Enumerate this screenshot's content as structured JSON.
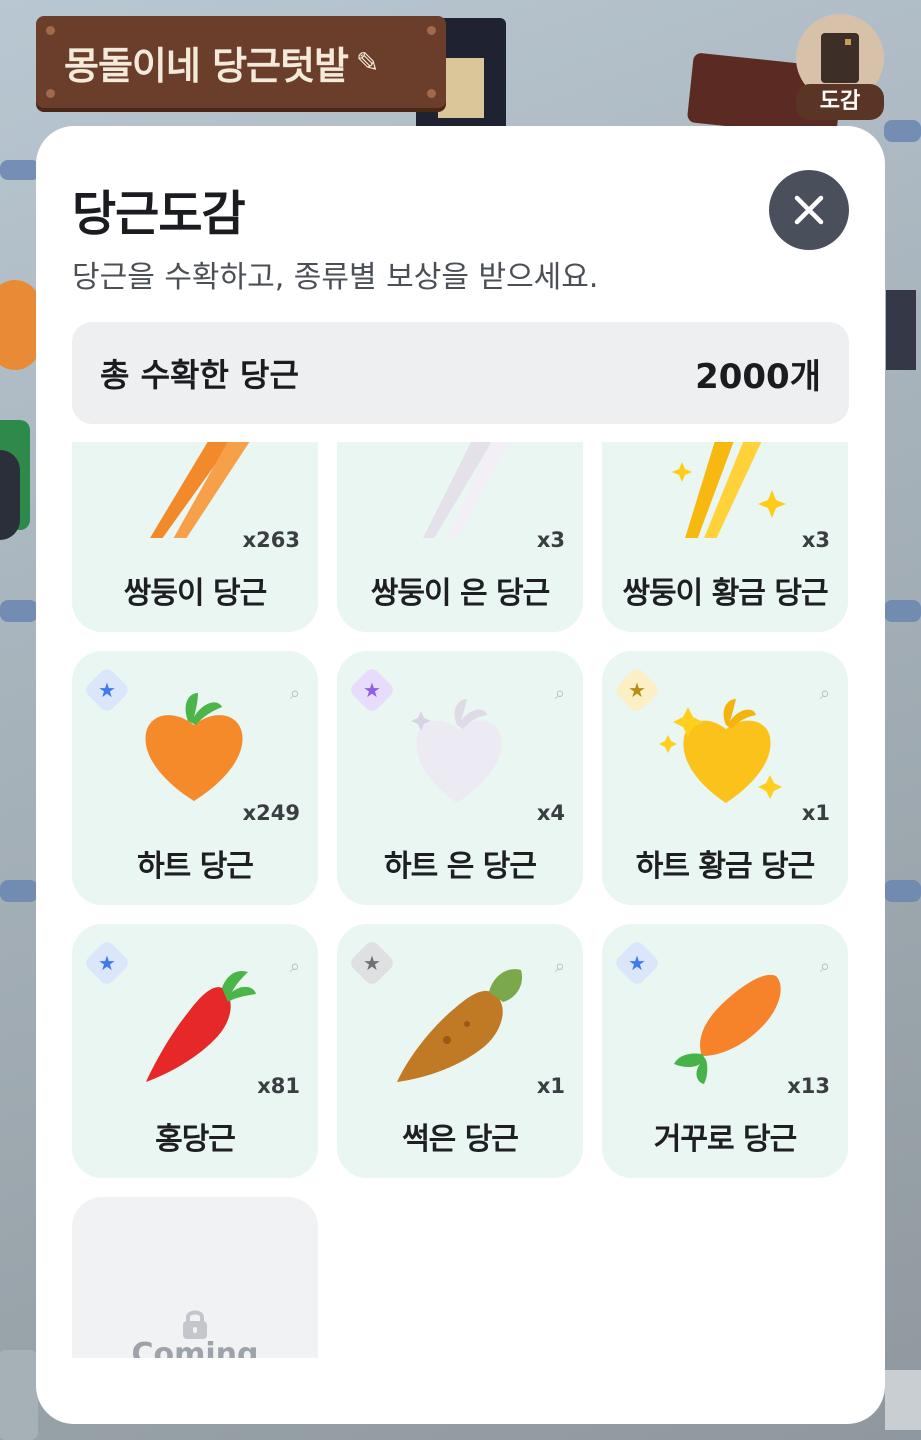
{
  "farm": {
    "name": "몽돌이네 당근텃밭"
  },
  "book_button": {
    "label": "도감"
  },
  "modal": {
    "title": "당근도감",
    "subtitle": "당근을 수확하고, 종류별 보상을 받으세요.",
    "total_label": "총 수확한 당근",
    "total_value": "2000개",
    "cards": [
      {
        "name": "쌍둥이 당근",
        "count": "x263"
      },
      {
        "name": "쌍둥이 은 당근",
        "count": "x3"
      },
      {
        "name": "쌍둥이 황금 당근",
        "count": "x3"
      },
      {
        "name": "하트 당근",
        "count": "x249"
      },
      {
        "name": "하트 은 당근",
        "count": "x4"
      },
      {
        "name": "하트 황금 당근",
        "count": "x1"
      },
      {
        "name": "홍당근",
        "count": "x81"
      },
      {
        "name": "썩은 당근",
        "count": "x1"
      },
      {
        "name": "거꾸로 당근",
        "count": "x13"
      }
    ],
    "locked_card": {
      "label": "Coming"
    }
  },
  "colors": {
    "card_bg": "#eaf6f2",
    "badge_blue": "#3f7bea",
    "badge_purple": "#8e5fe0",
    "badge_gold": "#b98d1a",
    "badge_gray": "#6e7276"
  }
}
